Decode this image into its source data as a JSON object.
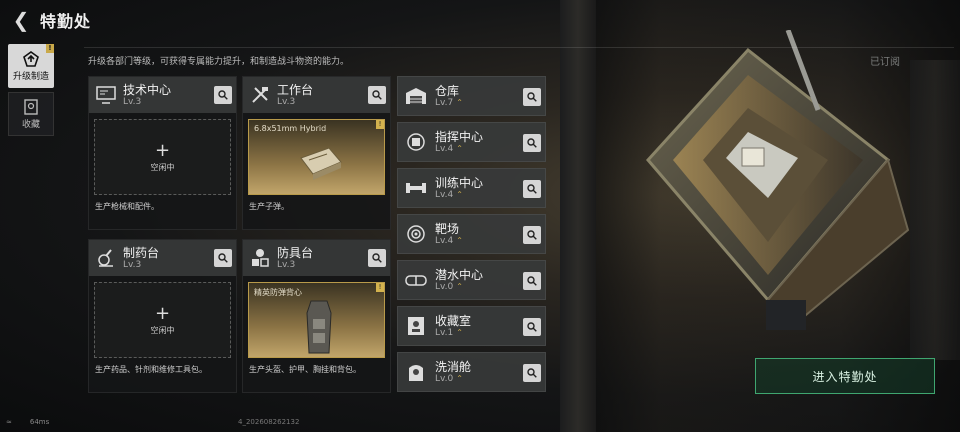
{
  "header": {
    "title": "特勤处"
  },
  "description": "升级各部门等级，可获得专属能力提升，和制造战斗物资的能力。",
  "subscribed_label": "已订阅",
  "sidebar": {
    "items": [
      {
        "label": "升级制造",
        "icon": "upgrade-icon",
        "badge": "!"
      },
      {
        "label": "收藏",
        "icon": "collection-icon"
      }
    ]
  },
  "stations": {
    "tech": {
      "name": "技术中心",
      "level": "Lv.3",
      "idle": "空闲中",
      "desc": "生产枪械和配件。"
    },
    "workbench": {
      "name": "工作台",
      "level": "Lv.3",
      "product": "6.8x51mm Hybrid",
      "badge": "!",
      "desc": "生产子弹。"
    },
    "pharmacy": {
      "name": "制药台",
      "level": "Lv.3",
      "idle": "空闲中",
      "desc": "生产药品、针剂和维修工具包。"
    },
    "armor": {
      "name": "防具台",
      "level": "Lv.3",
      "product": "精英防弹背心",
      "badge": "!",
      "desc": "生产头盔、护甲、胸挂和背包。"
    }
  },
  "facilities": [
    {
      "name": "仓库",
      "level": "Lv.7",
      "upgrade": true,
      "icon": "warehouse-icon"
    },
    {
      "name": "指挥中心",
      "level": "Lv.4",
      "upgrade": true,
      "icon": "command-icon"
    },
    {
      "name": "训练中心",
      "level": "Lv.4",
      "upgrade": true,
      "icon": "dumbbell-icon"
    },
    {
      "name": "靶场",
      "level": "Lv.4",
      "upgrade": true,
      "icon": "target-icon"
    },
    {
      "name": "潜水中心",
      "level": "Lv.0",
      "upgrade": true,
      "icon": "diving-icon"
    },
    {
      "name": "收藏室",
      "level": "Lv.1",
      "upgrade": true,
      "icon": "collection-room-icon"
    },
    {
      "name": "洗消舱",
      "level": "Lv.0",
      "upgrade": true,
      "icon": "decontamination-icon"
    }
  ],
  "enter_button": "进入特勤处",
  "status": {
    "ping": "64ms",
    "uid": "4_202608262132"
  },
  "colors": {
    "accent_gold": "#c9a94a",
    "enter_green": "#3fa670"
  }
}
